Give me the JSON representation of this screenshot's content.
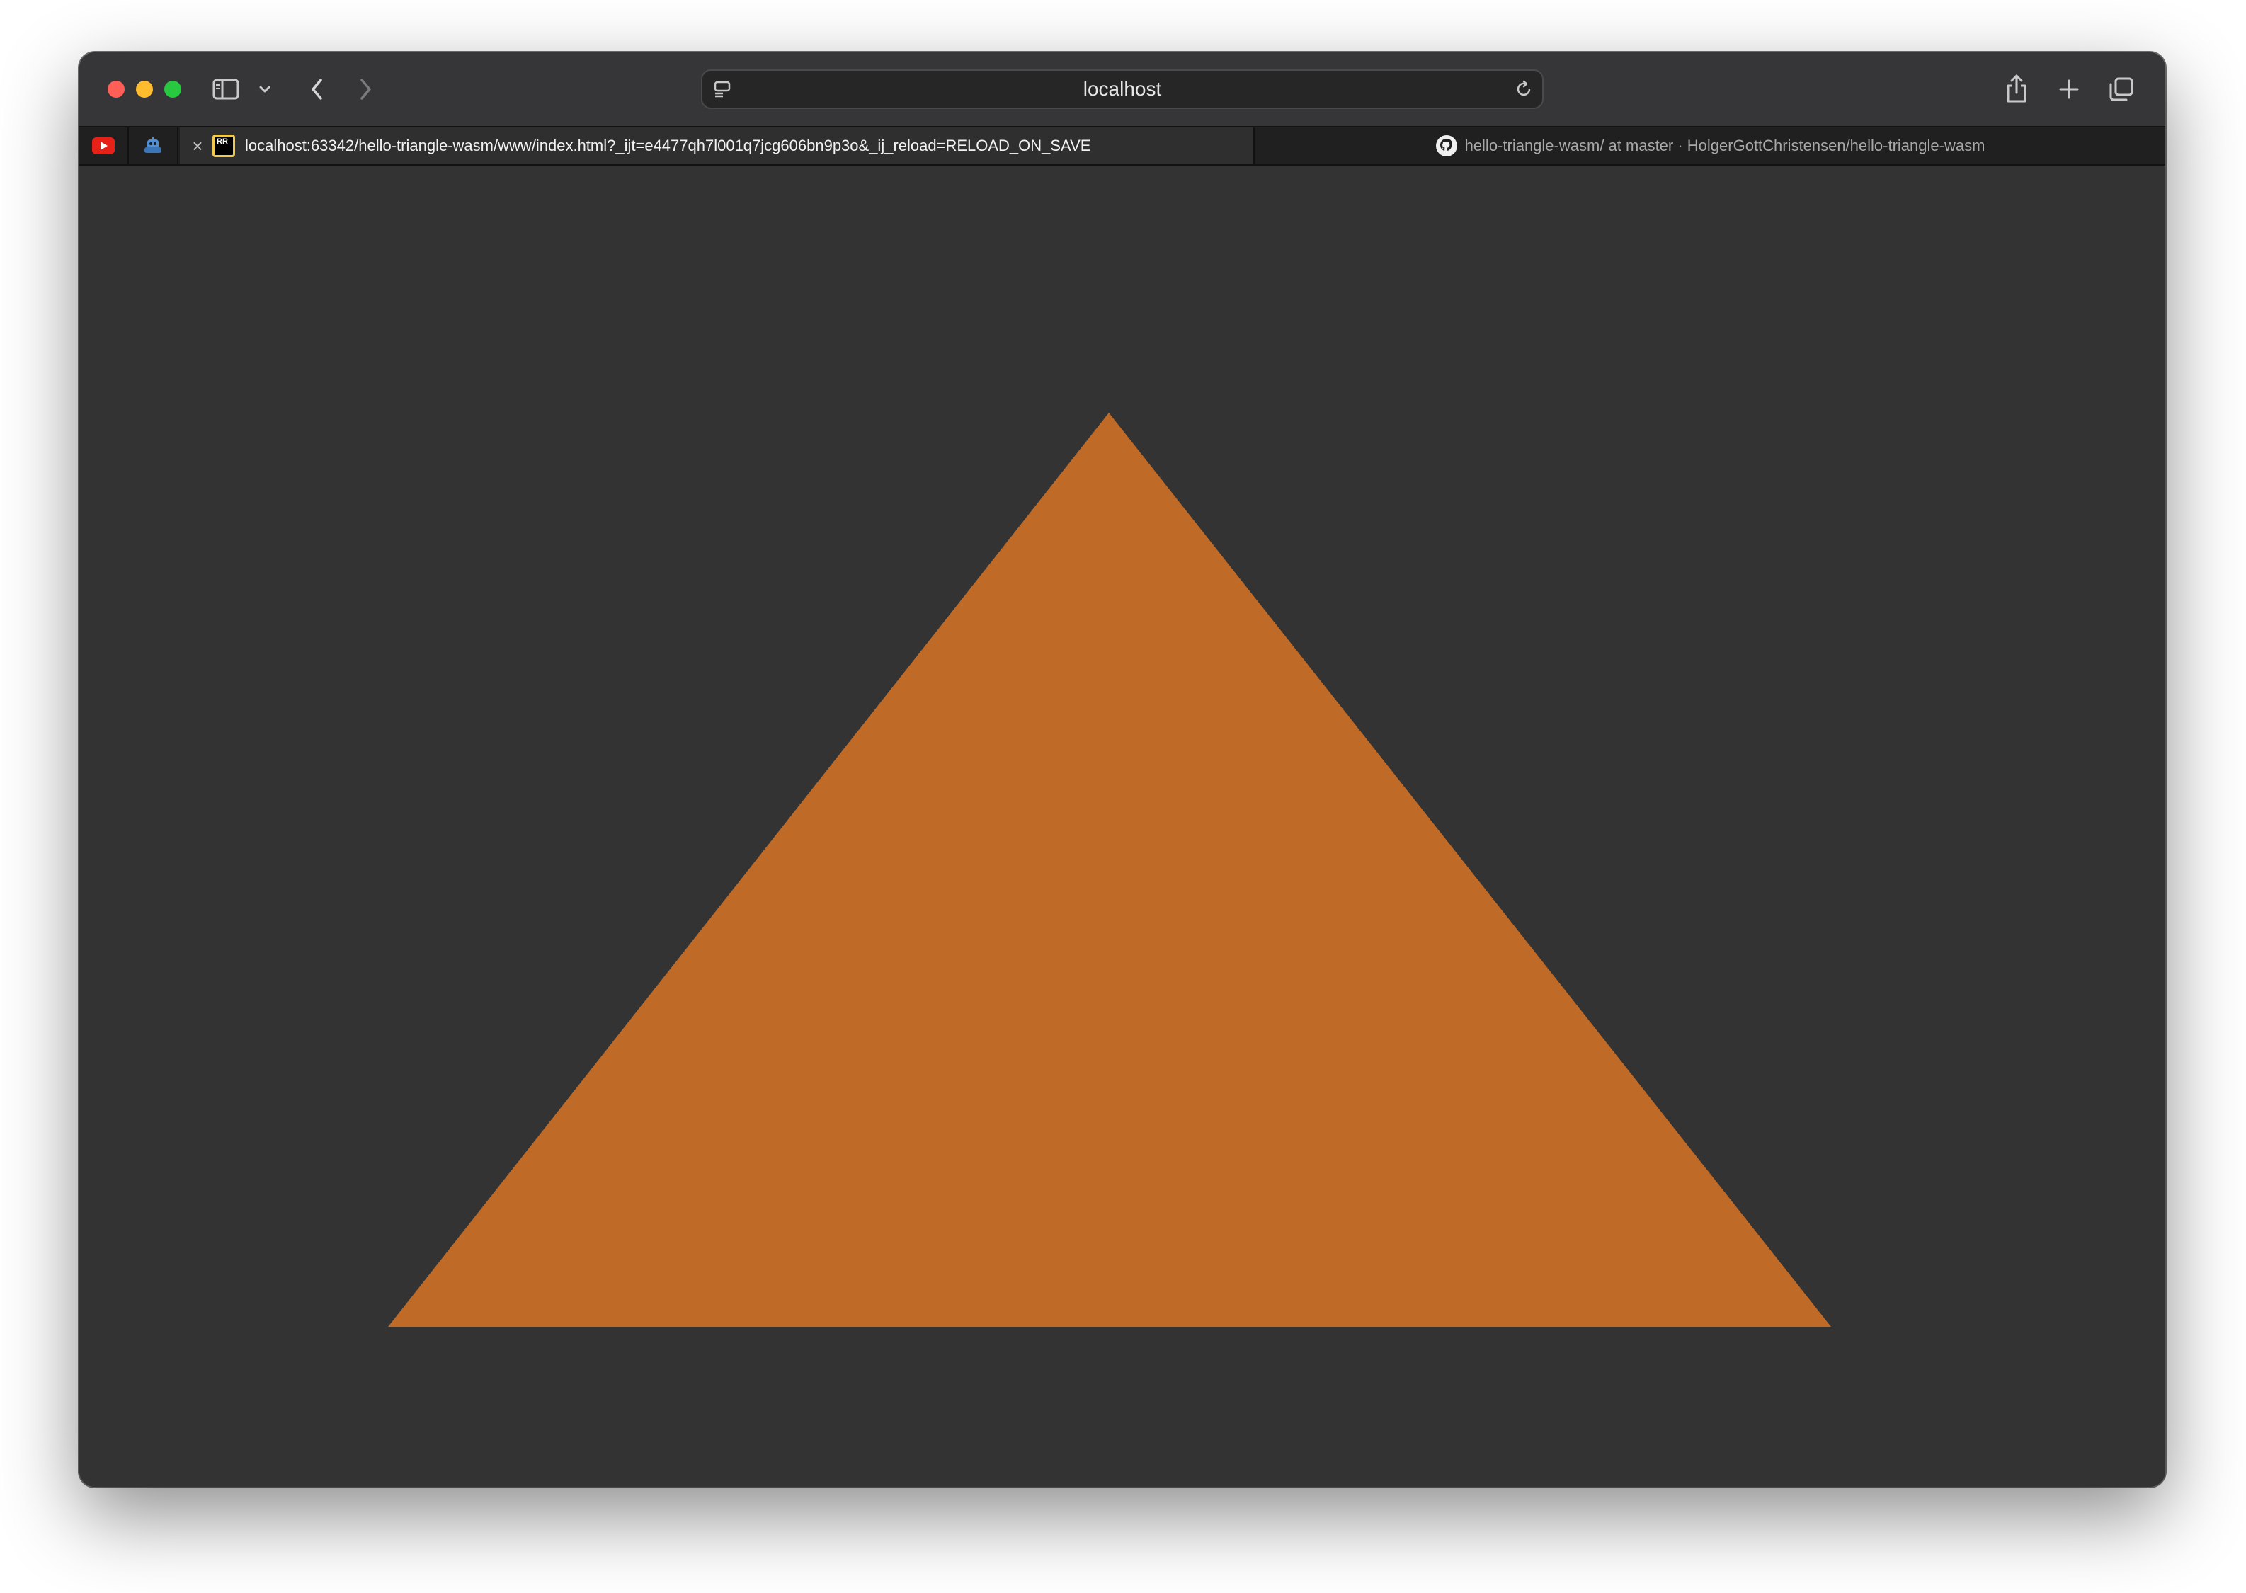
{
  "window": {
    "traffic_lights": [
      "close",
      "minimize",
      "zoom"
    ]
  },
  "toolbar": {
    "address": "localhost",
    "icons": [
      "sidebar-icon",
      "chevron-down-icon",
      "back-icon",
      "forward-icon",
      "page-menu-icon",
      "reload-icon",
      "share-icon",
      "new-tab-icon",
      "tab-overview-icon"
    ]
  },
  "tabs": {
    "pinned": [
      {
        "icon": "youtube-icon"
      },
      {
        "icon": "robot-icon"
      }
    ],
    "active": {
      "close_glyph": "×",
      "icon_label": "RR",
      "title": "localhost:63342/hello-triangle-wasm/www/index.html?_ijt=e4477qh7l001q7jcg606bn9p3o&_ij_reload=RELOAD_ON_SAVE"
    },
    "inactive": {
      "icon": "github-icon",
      "title": "hello-triangle-wasm/ at master · HolgerGottChristensen/hello-triangle-wasm"
    }
  },
  "page": {
    "background": "#333333",
    "triangle_color": "#bf6a27"
  }
}
